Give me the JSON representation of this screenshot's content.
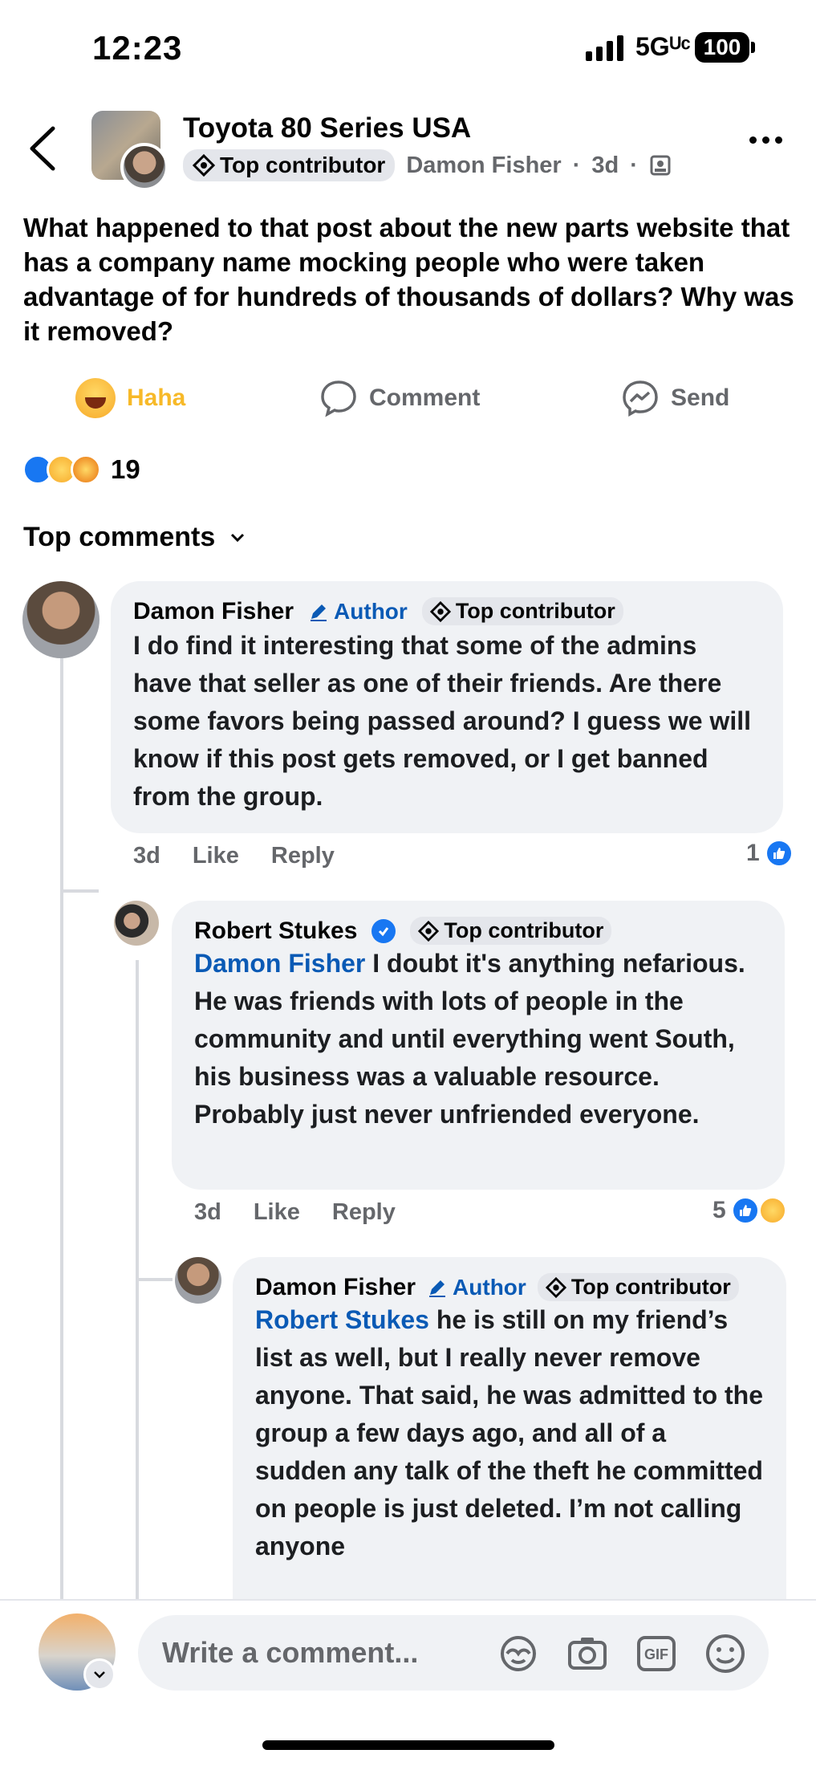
{
  "status_bar": {
    "time": "12:23",
    "network": "5Gᵁᶜ",
    "battery": "100"
  },
  "header": {
    "group_name": "Toyota 80 Series USA",
    "badge": "Top contributor",
    "author": "Damon Fisher",
    "time": "3d",
    "separator": "·"
  },
  "post": {
    "text": "What happened to that post about the new parts website that has a company name mocking people who were taken advantage of for hundreds of thousands of dollars? Why was it removed?"
  },
  "actions": {
    "haha": "Haha",
    "comment": "Comment",
    "send": "Send"
  },
  "reactions": {
    "count": "19"
  },
  "comments_header": {
    "label": "Top comments"
  },
  "comments": [
    {
      "name": "Damon Fisher",
      "author_tag": "Author",
      "badge": "Top contributor",
      "text": "I do find it interesting that some of the admins have that seller as one of their friends. Are there some favors being passed around? I guess we will know if this post gets removed, or I get banned from the group.",
      "time": "3d",
      "like": "Like",
      "reply": "Reply",
      "reactions": "1"
    },
    {
      "name": "Robert Stukes",
      "badge": "Top contributor",
      "mention": "Damon Fisher",
      "text": " I doubt it's anything nefarious. He was friends with lots of people in the community and until everything went South, his business was a valuable resource. Probably just never unfriended everyone.",
      "time": "3d",
      "like": "Like",
      "reply": "Reply",
      "reactions": "5"
    },
    {
      "name": "Damon Fisher",
      "author_tag": "Author",
      "badge": "Top contributor",
      "mention": "Robert Stukes",
      "text": " he is still on my friend’s list as well, but I really never remove anyone. That said, he was admitted to the group a few days ago, and all of a sudden any talk of the theft he committed on people is just deleted. I’m not calling anyone"
    }
  ],
  "composer": {
    "placeholder": "Write a comment..."
  },
  "colors": {
    "link": "#0a5ab5",
    "haha": "#f7b928",
    "like": "#1877f2",
    "bubble": "#f0f2f5",
    "muted": "#65676b"
  }
}
